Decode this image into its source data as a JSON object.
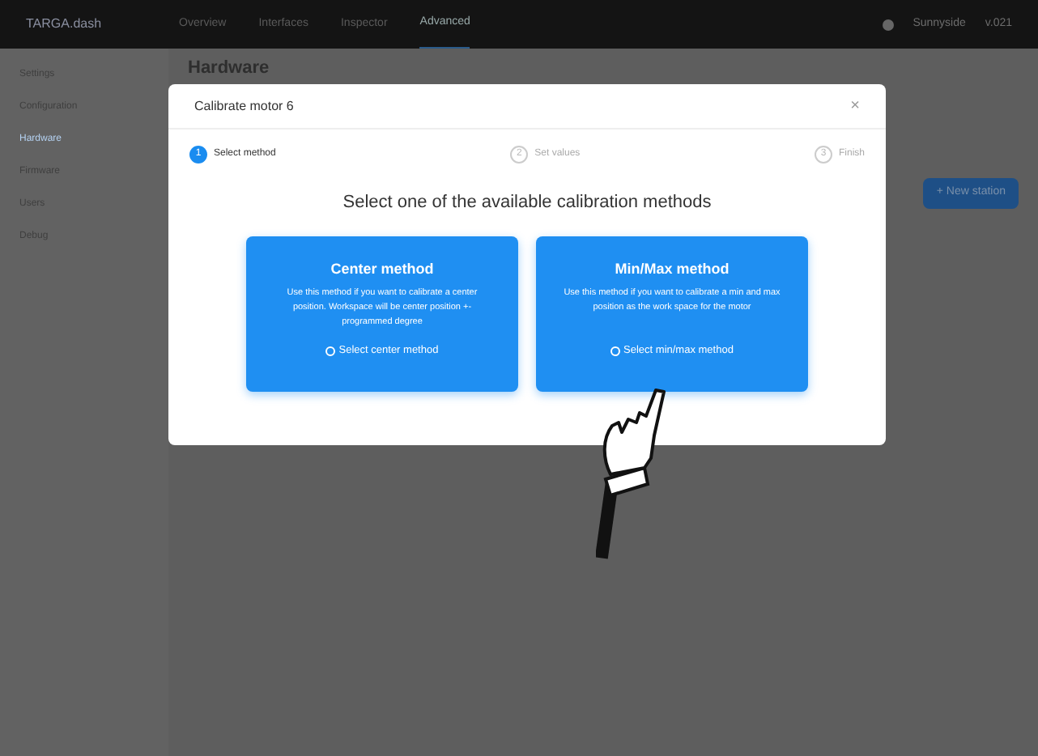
{
  "topbar": {
    "brand": "TARGA.dash",
    "nav": [
      {
        "label": "Overview",
        "selected": false
      },
      {
        "label": "Interfaces",
        "selected": false
      },
      {
        "label": "Inspector",
        "selected": false
      },
      {
        "label": "Advanced",
        "selected": true
      }
    ],
    "user": "Sunnyside",
    "version": "v.021"
  },
  "sidebar": {
    "items": [
      {
        "label": "Settings",
        "selected": false
      },
      {
        "label": "Configuration",
        "selected": false
      },
      {
        "label": "Hardware",
        "selected": true
      },
      {
        "label": "Firmware",
        "selected": false
      },
      {
        "label": "Users",
        "selected": false
      },
      {
        "label": "Debug",
        "selected": false
      }
    ]
  },
  "page": {
    "title": "Hardware",
    "new_button": "+ New station"
  },
  "dialog": {
    "title": "Calibrate motor 6",
    "close": "×",
    "steps": [
      {
        "number": "1",
        "label": "Select method",
        "selected": true
      },
      {
        "number": "2",
        "label": "Set values",
        "selected": false
      },
      {
        "number": "3",
        "label": "Finish",
        "selected": false
      }
    ],
    "heading": "Select one of the available calibration methods",
    "methods": [
      {
        "title": "Center method",
        "description": "Use this method if you want to calibrate a center position. Workspace will be center position +- programmed degree",
        "action": "Select center method"
      },
      {
        "title": "Min/Max method",
        "description": "Use this method if you want to calibrate a min and max position as the work space for the motor",
        "action": "Select min/max method"
      }
    ]
  }
}
